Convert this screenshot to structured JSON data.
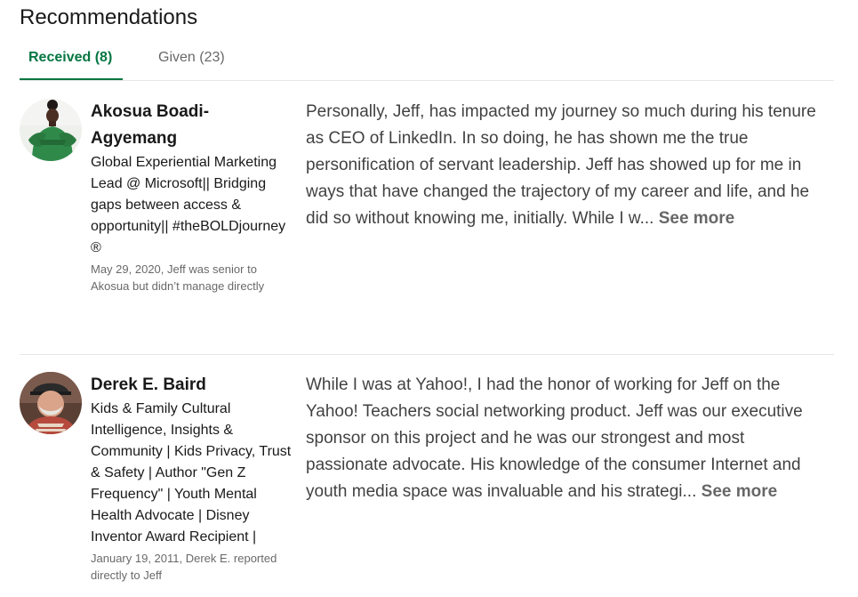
{
  "section": {
    "title": "Recommendations"
  },
  "tabs": [
    {
      "label": "Received (8)",
      "active": true
    },
    {
      "label": "Given (23)",
      "active": false
    }
  ],
  "colors": {
    "accent": "#057642",
    "divider": "#e6e6e6",
    "muted_text": "#666666"
  },
  "recommendations": [
    {
      "name_line1": "Akosua Boadi-",
      "name_line2": "Agyemang",
      "headline": "Global Experiential Marketing Lead @ Microsoft|| Bridging gaps between access & opportunity|| #theBOLDjourney ®",
      "relation": "May 29, 2020, Jeff was senior to Akosua but didn’t manage directly",
      "text": "Personally, Jeff, has impacted my journey so much during his tenure as CEO of LinkedIn. In so doing, he has shown me the true personification of servant leadership. Jeff has showed up for me in ways that have changed the trajectory of my career and life, and he did so without knowing me, initially. While I w...",
      "see_more": "See more",
      "avatar_icon": "profile-photo-woman-green-dress"
    },
    {
      "name": "Derek E. Baird",
      "headline": "Kids & Family Cultural Intelligence, Insights & Community | Kids Privacy, Trust & Safety | Author \"Gen Z Frequency\" | Youth Mental Health Advocate | Disney Inventor Award Recipient |",
      "relation": "January 19, 2011, Derek E. reported directly to Jeff",
      "text": "While I was at Yahoo!, I had the honor of working for Jeff on the Yahoo! Teachers social networking product. Jeff was our executive sponsor on this project and he was our strongest and most passionate advocate. His knowledge of the consumer Internet and youth media space was invaluable and his strategi...",
      "see_more": "See more",
      "avatar_icon": "profile-photo-man-cap"
    }
  ]
}
